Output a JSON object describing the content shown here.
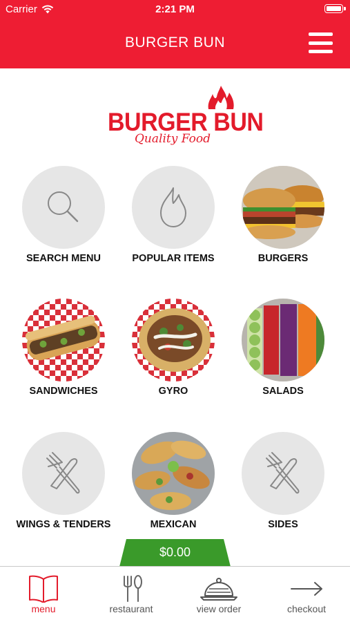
{
  "status_bar": {
    "carrier": "Carrier",
    "time": "2:21 PM"
  },
  "nav": {
    "title": "BURGER BUN",
    "menu_icon": "hamburger-menu-icon"
  },
  "brand": {
    "name": "BURGER BUN",
    "tagline": "Quality Food",
    "color": "#e31b2b"
  },
  "theme": {
    "accent": "#ee1d33",
    "cart_green": "#3a9a2a"
  },
  "categories": [
    {
      "label": "SEARCH MENU",
      "icon": "search-icon"
    },
    {
      "label": "POPULAR ITEMS",
      "icon": "flame-icon"
    },
    {
      "label": "BURGERS",
      "icon": "burgers-photo"
    },
    {
      "label": "SANDWICHES",
      "icon": "sandwich-photo"
    },
    {
      "label": "GYRO",
      "icon": "gyro-photo"
    },
    {
      "label": "SALADS",
      "icon": "salad-photo"
    },
    {
      "label": "WINGS & TENDERS",
      "icon": "fork-knife-icon"
    },
    {
      "label": "MEXICAN",
      "icon": "mexican-photo"
    },
    {
      "label": "SIDES",
      "icon": "fork-knife-icon"
    }
  ],
  "cart": {
    "total": "$0.00"
  },
  "tabs": [
    {
      "label": "menu",
      "icon": "open-book-icon",
      "active": true
    },
    {
      "label": "restaurant",
      "icon": "fork-spoon-icon",
      "active": false
    },
    {
      "label": "view order",
      "icon": "cloche-icon",
      "active": false
    },
    {
      "label": "checkout",
      "icon": "arrow-right-icon",
      "active": false
    }
  ]
}
